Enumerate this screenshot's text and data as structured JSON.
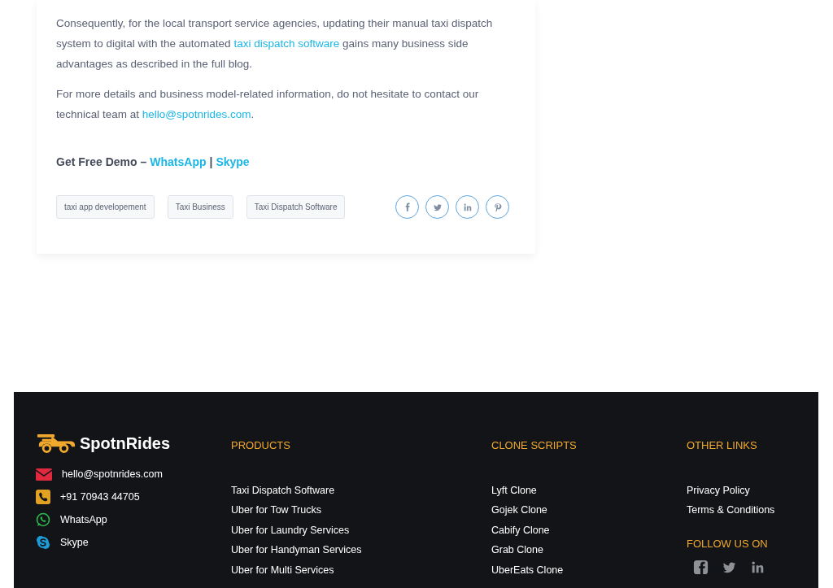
{
  "article": {
    "paragraphs": [
      {
        "parts": [
          {
            "text": "Consequently, for the local transport service agencies, updating their manual taxi dispatch system to digital with the automated "
          },
          {
            "link": "taxi dispatch software"
          },
          {
            "text": " gains many business side advantages as described in the full blog."
          }
        ]
      },
      {
        "parts": [
          {
            "text": "For more details and business model-related information, do not hesitate to contact our technical team at "
          },
          {
            "link": "hello@spotnrides.com"
          },
          {
            "text": "."
          }
        ]
      }
    ],
    "demo": {
      "label": "Get Free Demo –",
      "links": [
        "WhatsApp",
        "Skype"
      ],
      "separator": "|"
    },
    "tags": [
      "taxi app developement",
      "Taxi Business",
      "Taxi Dispatch Software"
    ],
    "share": [
      {
        "kind": "facebook"
      },
      {
        "kind": "twitter"
      },
      {
        "kind": "linkedin"
      },
      {
        "kind": "pinterest"
      }
    ]
  },
  "footer": {
    "brand": "SpotnRides",
    "contacts": [
      {
        "kind": "email",
        "text": "hello@spotnrides.com"
      },
      {
        "kind": "phone",
        "text": "+91 70943 44705"
      },
      {
        "kind": "whatsapp",
        "text": "WhatsApp"
      },
      {
        "kind": "skype",
        "text": "Skype"
      }
    ],
    "columns": [
      {
        "heading": "PRODUCTS",
        "links": [
          "Taxi Dispatch Software",
          "Uber for Tow Trucks",
          "Uber for Laundry Services",
          "Uber for Handyman Services",
          "Uber for Multi Services"
        ]
      },
      {
        "heading": "CLONE SCRIPTS",
        "links": [
          "Lyft Clone",
          "Gojek Clone",
          "Cabify Clone",
          "Grab Clone",
          "UberEats Clone"
        ]
      },
      {
        "heading": "OTHER LINKS",
        "links": [
          "Privacy Policy",
          "Terms & Conditions"
        ],
        "follow": {
          "heading": "FOLLOW US ON",
          "icons": [
            {
              "kind": "facebook"
            },
            {
              "kind": "twitter"
            },
            {
              "kind": "linkedin"
            }
          ]
        }
      }
    ]
  }
}
